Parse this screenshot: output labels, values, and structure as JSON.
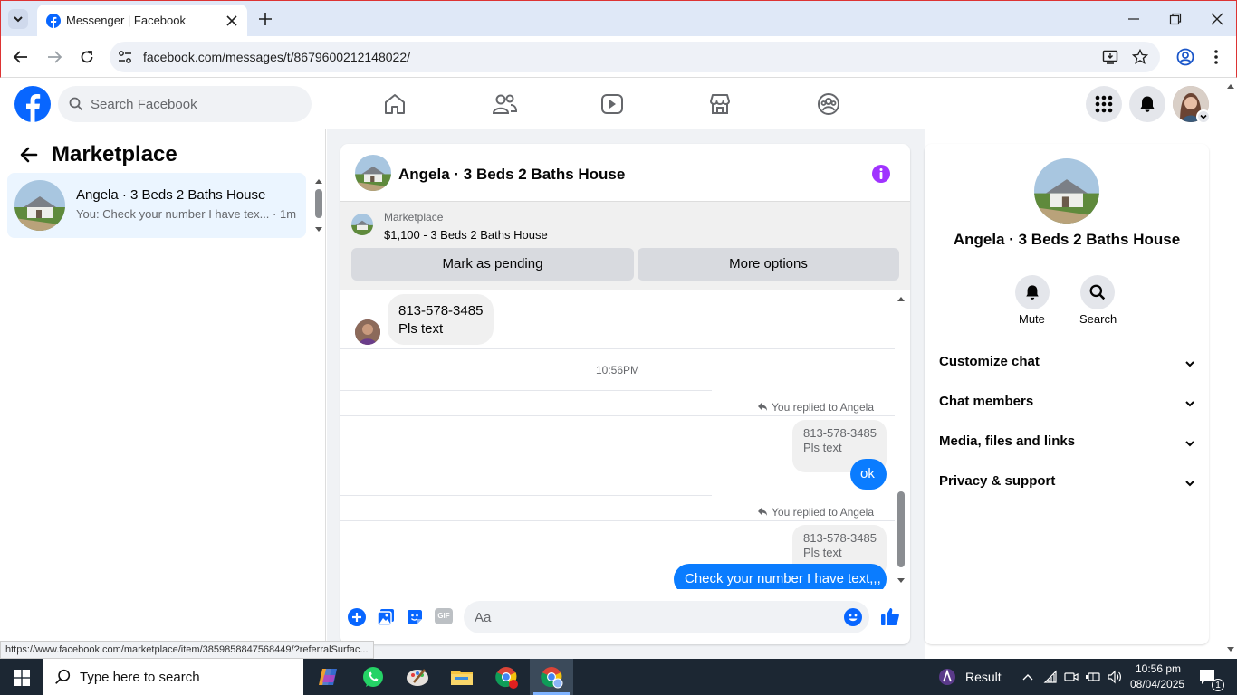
{
  "browser": {
    "tab_title": "Messenger | Facebook",
    "url": "facebook.com/messages/t/8679600212148022/"
  },
  "fb": {
    "search_placeholder": "Search Facebook"
  },
  "left": {
    "title": "Marketplace",
    "conversation": {
      "name": "Angela · 3 Beds 2 Baths House",
      "preview": "You: Check your number I have tex... · 1m"
    }
  },
  "chat": {
    "header_title": "Angela · 3 Beds 2 Baths House",
    "listing_source": "Marketplace",
    "listing_price_title": "$1,100 - 3 Beds 2 Baths House",
    "mark_pending": "Mark as pending",
    "more_options": "More options",
    "messages": {
      "in_line1": "813-578-3485",
      "in_line2": "Pls text",
      "time": "10:56PM",
      "reply_note_1": "You replied to Angela",
      "quote1_line1": "813-578-3485",
      "quote1_line2": "Pls text",
      "out1": "ok",
      "reply_note_2": "You replied to Angela",
      "quote2_line1": "813-578-3485",
      "quote2_line2": "Pls text",
      "out2": "Check your number I have text,,,"
    },
    "composer_placeholder": "Aa",
    "gif_label": "GIF"
  },
  "right": {
    "name": "Angela · 3 Beds 2 Baths House",
    "mute": "Mute",
    "search": "Search",
    "sections": [
      "Customize chat",
      "Chat members",
      "Media, files and links",
      "Privacy & support"
    ]
  },
  "status_url": "https://www.facebook.com/marketplace/item/3859858847568449/?referralSurfac...",
  "taskbar": {
    "search_placeholder": "Type here to search",
    "result": "Result",
    "time": "10:56 pm",
    "date": "08/04/2025",
    "notif_count": "1"
  },
  "colors": {
    "fb_blue": "#0866ff",
    "messenger_blue": "#0a7cff",
    "accent_purple": "#a033ff"
  }
}
